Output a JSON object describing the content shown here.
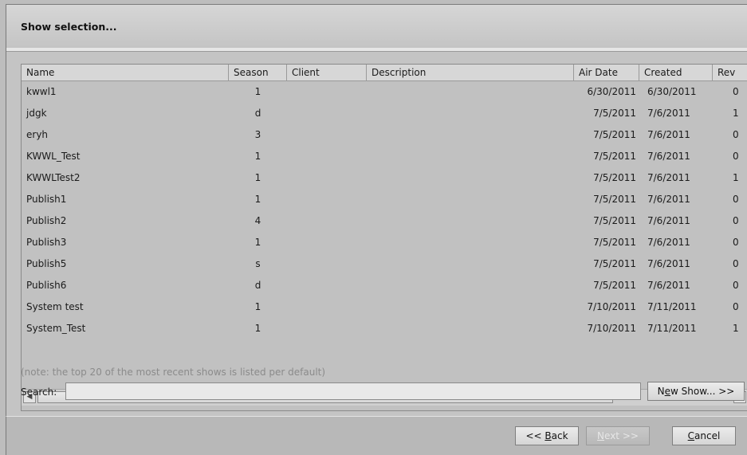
{
  "dialog": {
    "title": "Show selection..."
  },
  "table": {
    "columns": [
      "Name",
      "Season",
      "Client",
      "Description",
      "Air Date",
      "Created",
      "Rev"
    ],
    "rows": [
      {
        "name": "kwwl1",
        "season": "1",
        "client": "",
        "description": "",
        "air_date": "6/30/2011",
        "created": "6/30/2011",
        "rev": "0"
      },
      {
        "name": "jdgk",
        "season": "d",
        "client": "",
        "description": "",
        "air_date": "7/5/2011",
        "created": "7/6/2011",
        "rev": "1"
      },
      {
        "name": "eryh",
        "season": "3",
        "client": "",
        "description": "",
        "air_date": "7/5/2011",
        "created": "7/6/2011",
        "rev": "0"
      },
      {
        "name": "KWWL_Test",
        "season": "1",
        "client": "",
        "description": "",
        "air_date": "7/5/2011",
        "created": "7/6/2011",
        "rev": "0"
      },
      {
        "name": "KWWLTest2",
        "season": "1",
        "client": "",
        "description": "",
        "air_date": "7/5/2011",
        "created": "7/6/2011",
        "rev": "1"
      },
      {
        "name": "Publish1",
        "season": "1",
        "client": "",
        "description": "",
        "air_date": "7/5/2011",
        "created": "7/6/2011",
        "rev": "0"
      },
      {
        "name": "Publish2",
        "season": "4",
        "client": "",
        "description": "",
        "air_date": "7/5/2011",
        "created": "7/6/2011",
        "rev": "0"
      },
      {
        "name": "Publish3",
        "season": "1",
        "client": "",
        "description": "",
        "air_date": "7/5/2011",
        "created": "7/6/2011",
        "rev": "0"
      },
      {
        "name": "Publish5",
        "season": "s",
        "client": "",
        "description": "",
        "air_date": "7/5/2011",
        "created": "7/6/2011",
        "rev": "0"
      },
      {
        "name": "Publish6",
        "season": "d",
        "client": "",
        "description": "",
        "air_date": "7/5/2011",
        "created": "7/6/2011",
        "rev": "0"
      },
      {
        "name": "System test",
        "season": "1",
        "client": "",
        "description": "",
        "air_date": "7/10/2011",
        "created": "7/11/2011",
        "rev": "0"
      },
      {
        "name": "System_Test",
        "season": "1",
        "client": "",
        "description": "",
        "air_date": "7/10/2011",
        "created": "7/11/2011",
        "rev": "1"
      }
    ]
  },
  "scrollbar": {
    "left_icon": "arrow-left-icon",
    "right_icon": "arrow-right-icon"
  },
  "note": "(note: the top 20 of the most recent shows is listed per default)",
  "search": {
    "label": "Search:",
    "value": ""
  },
  "buttons": {
    "new_show_pre": "N",
    "new_show_acc": "e",
    "new_show_post": "w Show... >>",
    "back_pre": "<< ",
    "back_acc": "B",
    "back_post": "ack",
    "next_pre": "",
    "next_acc": "N",
    "next_post": "ext >>",
    "cancel_pre": "",
    "cancel_acc": "C",
    "cancel_post": "ancel"
  },
  "colors": {
    "background": "#bdbdbd",
    "note_text": "#8b8b8b"
  }
}
